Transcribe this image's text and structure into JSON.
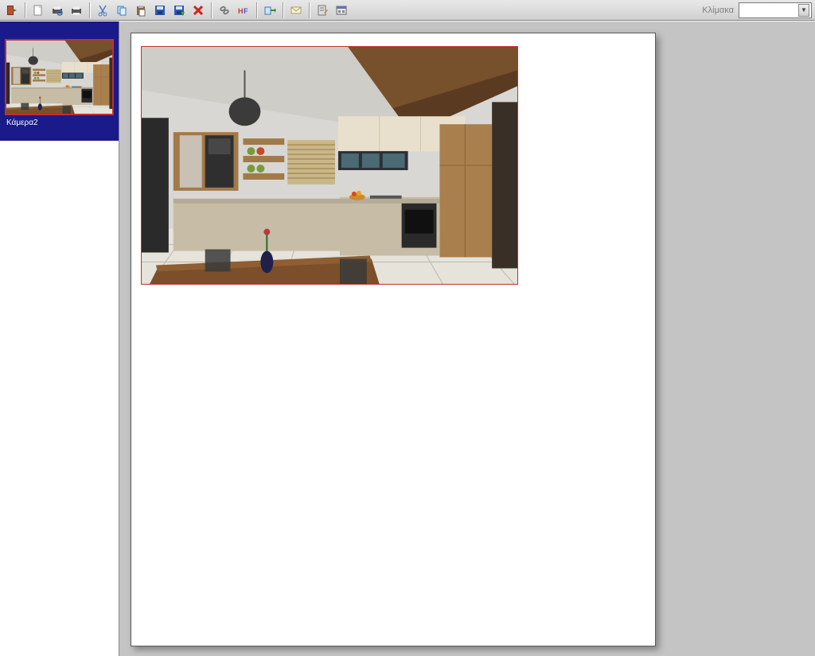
{
  "toolbar": {
    "exit_icon": "exit-icon",
    "new_icon": "new-doc-icon",
    "print_preview_icon": "print-preview-icon",
    "print_icon": "print-icon",
    "cut_icon": "cut-icon",
    "copy_icon": "copy-icon",
    "paste_icon": "paste-icon",
    "diskette_blue_icon": "save-icon",
    "diskette_green_icon": "save-as-icon",
    "delete_icon": "delete-icon",
    "link_icon": "link-icon",
    "header_footer_icon": "header-footer-icon",
    "export_icon": "export-icon",
    "email_icon": "email-icon",
    "note_icon": "note-icon",
    "panel_icon": "panel-icon",
    "scale_label": "Κλίμακα",
    "scale_value": ""
  },
  "thumbnails": {
    "items": [
      {
        "caption": "Κάμερα2"
      }
    ]
  },
  "colors": {
    "panel_bg": "#c4c4c4",
    "thumb_bg": "#1a1a8a",
    "selection_border": "#c03030"
  }
}
